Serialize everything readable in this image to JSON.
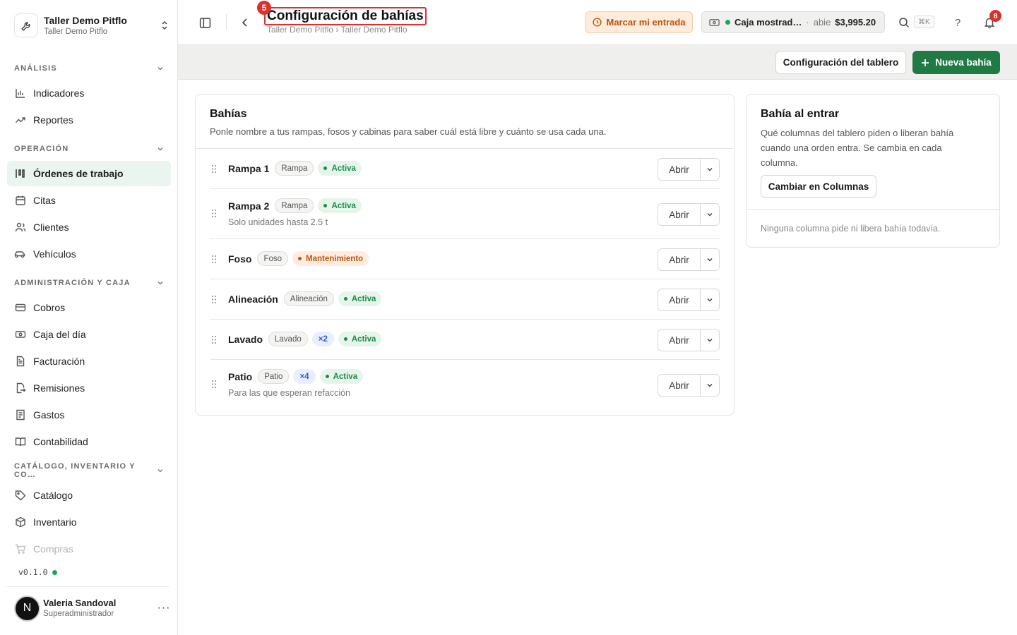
{
  "org": {
    "name": "Taller Demo Pitflo",
    "subtitle": "Taller Demo Pitflo"
  },
  "nav": {
    "sections": [
      {
        "label": "ANÁLISIS",
        "items": [
          "Indicadores",
          "Reportes"
        ]
      },
      {
        "label": "OPERACIÓN",
        "items": [
          "Órdenes de trabajo",
          "Citas",
          "Clientes",
          "Vehículos"
        ]
      },
      {
        "label": "ADMINISTRACIÓN Y CAJA",
        "items": [
          "Cobros",
          "Caja del día",
          "Facturación",
          "Remisiones",
          "Gastos",
          "Contabilidad"
        ]
      },
      {
        "label": "CATÁLOGO, INVENTARIO Y CO…",
        "items": [
          "Catálogo",
          "Inventario",
          "Compras"
        ]
      }
    ],
    "active": "Órdenes de trabajo"
  },
  "version": "v0.1.0",
  "user": {
    "initial": "N",
    "name": "Valeria Sandoval",
    "role": "Superadministrador"
  },
  "header": {
    "step": "5",
    "title": "Configuración de bahías",
    "breadcrumb": "Taller Demo Pitflo › Taller Demo Pitflo",
    "clock_in_label": "Marcar mi entrada",
    "cash": {
      "name": "Caja mostrad…",
      "separator": "·",
      "state": "abie",
      "amount": "$3,995.20"
    },
    "search_shortcut": "⌘K",
    "help_label": "?",
    "notifications": "8"
  },
  "toolbar": {
    "board_config_label": "Configuración del tablero",
    "new_bay_label": "Nueva bahía"
  },
  "bays": {
    "title": "Bahías",
    "description": "Ponle nombre a tus rampas, fosos y cabinas para saber cuál está libre y cuánto se usa cada una.",
    "open_label": "Abrir",
    "items": [
      {
        "name": "Rampa 1",
        "type": "Rampa",
        "multiplier": "",
        "status": "Activa",
        "status_kind": "ok",
        "note": ""
      },
      {
        "name": "Rampa 2",
        "type": "Rampa",
        "multiplier": "",
        "status": "Activa",
        "status_kind": "ok",
        "note": "Solo unidades hasta 2.5 t"
      },
      {
        "name": "Foso",
        "type": "Foso",
        "multiplier": "",
        "status": "Mantenimiento",
        "status_kind": "warn",
        "note": ""
      },
      {
        "name": "Alineación",
        "type": "Alineación",
        "multiplier": "",
        "status": "Activa",
        "status_kind": "ok",
        "note": ""
      },
      {
        "name": "Lavado",
        "type": "Lavado",
        "multiplier": "×2",
        "status": "Activa",
        "status_kind": "ok",
        "note": ""
      },
      {
        "name": "Patio",
        "type": "Patio",
        "multiplier": "×4",
        "status": "Activa",
        "status_kind": "ok",
        "note": "Para las que esperan refacción"
      }
    ]
  },
  "entry": {
    "title": "Bahía al entrar",
    "description": "Qué columnas del tablero piden o liberan bahía cuando una orden entra. Se cambia en cada columna.",
    "button_label": "Cambiar en Columnas",
    "empty_text": "Ninguna columna pide ni libera bahía todavía."
  },
  "colors": {
    "accent": "#1f7a44",
    "active_bg": "#e9f5ee",
    "badge": "#d8322e",
    "warn": "#c2560e"
  }
}
